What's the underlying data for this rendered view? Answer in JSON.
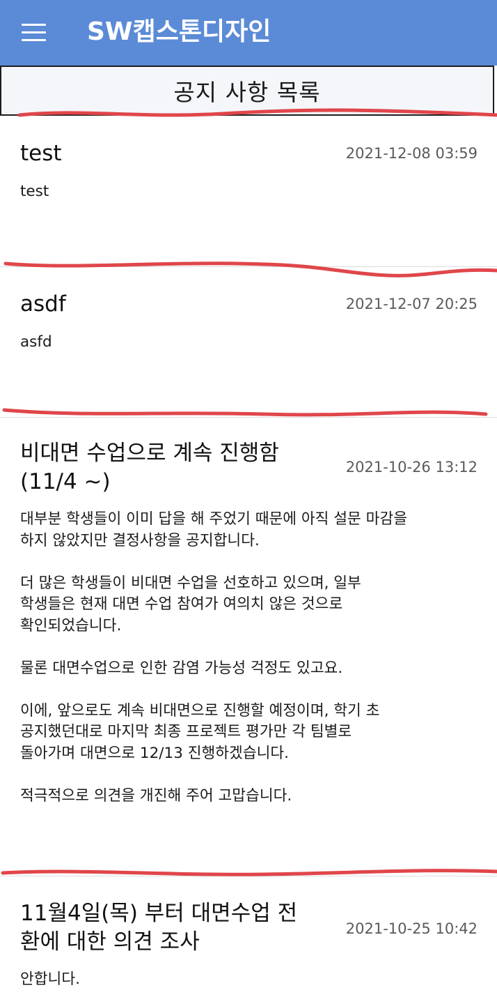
{
  "app_bar": {
    "title": "SW캡스톤디자인",
    "menu_icon": "hamburger-menu-icon",
    "background_color": "#5b8bd6"
  },
  "section": {
    "title": "공지 사항 목록"
  },
  "annotation_color": "#e0464a",
  "notices": [
    {
      "title": "test",
      "date": "2021-12-08 03:59",
      "body": "test"
    },
    {
      "title": "asdf",
      "date": "2021-12-07 20:25",
      "body": "asfd"
    },
    {
      "title": "비대면 수업으로 계속 진행함 (11/4 ~)",
      "date": "2021-10-26 13:12",
      "body": "대부분 학생들이 이미 답을 해 주었기 때문에 아직 설문 마감을\n하지 않았지만 결정사항을 공지합니다.\n\n더 많은 학생들이 비대면 수업을 선호하고 있으며, 일부\n학생들은 현재 대면 수업 참여가 여의치 않은 것으로\n확인되었습니다.\n\n물론 대면수업으로 인한 감염 가능성 걱정도 있고요.\n\n이에, 앞으로도 계속 비대면으로 진행할 예정이며, 학기 초\n공지했던대로 마지막 최종 프로젝트 평가만 각 팀별로\n돌아가며 대면으로 12/13 진행하겠습니다.\n\n적극적으로 의견을 개진해 주어 고맙습니다."
    },
    {
      "title": "11월4일(목) 부터 대면수업 전환에 대한 의견 조사",
      "date": "2021-10-25 10:42",
      "body": "안합니다."
    }
  ]
}
